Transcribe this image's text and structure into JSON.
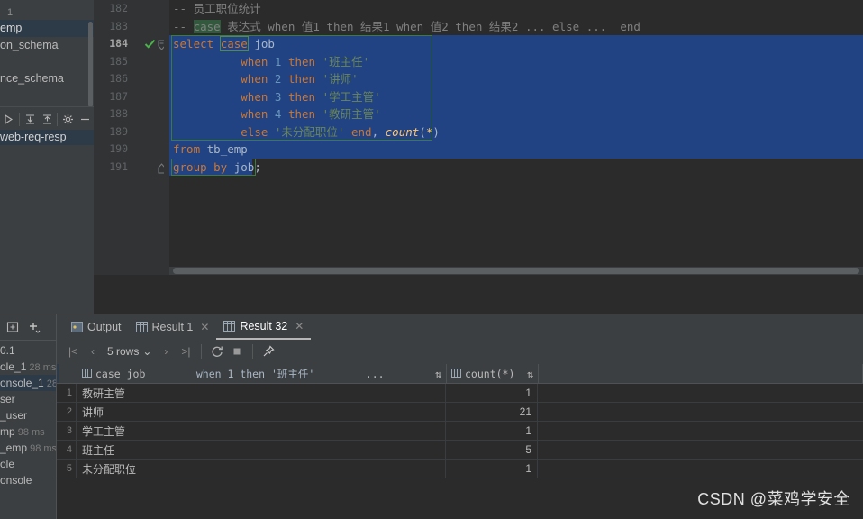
{
  "sidebar": {
    "top_number": "1",
    "tree_items": [
      {
        "label": "emp",
        "selected": true
      },
      {
        "label": "on_schema",
        "selected": false
      },
      {
        "label": "",
        "selected": false
      },
      {
        "label": "nce_schema",
        "selected": false
      }
    ],
    "toolbar_icons": [
      "run-icon",
      "expand-all-icon",
      "collapse-all-icon",
      "gear-icon",
      "minus-icon"
    ],
    "selected_row": "web-req-resp"
  },
  "editor": {
    "lines": [
      {
        "num": "182",
        "current": false,
        "check": false,
        "fold": "none",
        "selection": "none",
        "tokens": [
          {
            "t": "comment",
            "v": "-- 员工职位统计"
          }
        ]
      },
      {
        "num": "183",
        "current": false,
        "check": false,
        "fold": "none",
        "selection": "none",
        "tokens": [
          {
            "t": "comment",
            "v": "-- "
          },
          {
            "t": "comment-hl",
            "v": "case"
          },
          {
            "t": "comment",
            "v": " 表达式 when 值1 then 结果1 when 值2 then 结果2 ... else ...  end"
          }
        ]
      },
      {
        "num": "184",
        "current": true,
        "check": true,
        "fold": "open",
        "selection": "full",
        "tokens": [
          {
            "t": "kw",
            "v": "select "
          },
          {
            "t": "kw-box",
            "v": "case"
          },
          {
            "t": "ident",
            "v": " job"
          }
        ]
      },
      {
        "num": "185",
        "current": false,
        "check": false,
        "fold": "none",
        "selection": "full",
        "tokens": [
          {
            "t": "plain",
            "v": "          "
          },
          {
            "t": "kw",
            "v": "when "
          },
          {
            "t": "num",
            "v": "1"
          },
          {
            "t": "kw",
            "v": " then "
          },
          {
            "t": "str",
            "v": "'班主任'"
          }
        ]
      },
      {
        "num": "186",
        "current": false,
        "check": false,
        "fold": "none",
        "selection": "full",
        "tokens": [
          {
            "t": "plain",
            "v": "          "
          },
          {
            "t": "kw",
            "v": "when "
          },
          {
            "t": "num",
            "v": "2"
          },
          {
            "t": "kw",
            "v": " then "
          },
          {
            "t": "str",
            "v": "'讲师'"
          }
        ]
      },
      {
        "num": "187",
        "current": false,
        "check": false,
        "fold": "none",
        "selection": "full",
        "tokens": [
          {
            "t": "plain",
            "v": "          "
          },
          {
            "t": "kw",
            "v": "when "
          },
          {
            "t": "num",
            "v": "3"
          },
          {
            "t": "kw",
            "v": " then "
          },
          {
            "t": "str",
            "v": "'学工主管'"
          }
        ]
      },
      {
        "num": "188",
        "current": false,
        "check": false,
        "fold": "none",
        "selection": "full",
        "tokens": [
          {
            "t": "plain",
            "v": "          "
          },
          {
            "t": "kw",
            "v": "when "
          },
          {
            "t": "num",
            "v": "4"
          },
          {
            "t": "kw",
            "v": " then "
          },
          {
            "t": "str",
            "v": "'教研主管'"
          }
        ]
      },
      {
        "num": "189",
        "current": false,
        "check": false,
        "fold": "none",
        "selection": "full",
        "tokens": [
          {
            "t": "plain",
            "v": "          "
          },
          {
            "t": "kw",
            "v": "else "
          },
          {
            "t": "str",
            "v": "'未分配职位'"
          },
          {
            "t": "kw",
            "v": " end"
          },
          {
            "t": "op",
            "v": ", "
          },
          {
            "t": "fn",
            "v": "count"
          },
          {
            "t": "op",
            "v": "("
          },
          {
            "t": "fn-star",
            "v": "*"
          },
          {
            "t": "op",
            "v": ")"
          }
        ]
      },
      {
        "num": "190",
        "current": false,
        "check": false,
        "fold": "none",
        "selection": "full",
        "tokens": [
          {
            "t": "kw",
            "v": "from "
          },
          {
            "t": "ident",
            "v": "tb_emp"
          }
        ]
      },
      {
        "num": "191",
        "current": false,
        "check": false,
        "fold": "close",
        "selection": "partial",
        "tokens": [
          {
            "t": "kw",
            "v": "group by "
          },
          {
            "t": "ident",
            "v": "job"
          },
          {
            "t": "op",
            "v": ";"
          }
        ]
      }
    ]
  },
  "history": {
    "toolbar_icons": [
      "new-console-icon",
      "add-icon"
    ],
    "items": [
      {
        "label": "0.1",
        "time": "",
        "selected": false
      },
      {
        "label": "ole_1",
        "time": "28 ms",
        "selected": false
      },
      {
        "label": "onsole_1",
        "time": "28",
        "selected": true
      },
      {
        "label": "ser",
        "time": "",
        "selected": false
      },
      {
        "label": "_user",
        "time": "",
        "selected": false
      },
      {
        "label": "mp",
        "time": "98 ms",
        "selected": false
      },
      {
        "label": "_emp",
        "time": "98 ms",
        "selected": false
      },
      {
        "label": "ole",
        "time": "",
        "selected": false
      },
      {
        "label": "onsole",
        "time": "",
        "selected": false
      }
    ]
  },
  "bottom_panel": {
    "tabs": [
      {
        "label": "Output",
        "icon": "output-icon",
        "active": false,
        "closable": false
      },
      {
        "label": "Result 1",
        "icon": "table-icon",
        "active": false,
        "closable": true
      },
      {
        "label": "Result 32",
        "icon": "table-icon",
        "active": true,
        "closable": true
      }
    ],
    "result_toolbar": {
      "first_label": "|<",
      "prev_label": "‹",
      "rows_label": "5 rows",
      "rows_chevron": "⌄",
      "next_label": "›",
      "last_label": ">|",
      "icons": [
        "refresh-icon",
        "stop-icon",
        "pin-icon"
      ]
    }
  },
  "result_grid": {
    "columns": [
      {
        "key": "col1",
        "icon": "column-icon",
        "label": "case job",
        "mid": "when 1 then '班主任'",
        "ellipsis": "...",
        "sort": "⇅"
      },
      {
        "key": "col2",
        "icon": "column-icon",
        "label": "count(*)",
        "mid": "",
        "ellipsis": "",
        "sort": "⇅"
      }
    ],
    "rows": [
      {
        "n": "1",
        "col1": "教研主管",
        "col2": "1"
      },
      {
        "n": "2",
        "col1": "讲师",
        "col2": "21"
      },
      {
        "n": "3",
        "col1": "学工主管",
        "col2": "1"
      },
      {
        "n": "4",
        "col1": "班主任",
        "col2": "5"
      },
      {
        "n": "5",
        "col1": "未分配职位",
        "col2": "1"
      }
    ]
  },
  "watermark": {
    "text": "CSDN @菜鸡学安全"
  },
  "colors": {
    "editor_bg": "#2b2b2b",
    "panel_bg": "#3c3f41",
    "gutter_bg": "#313335",
    "selection_blue": "#214283",
    "statement_outline_green": "#3b7a45",
    "keyword_orange": "#cc7832",
    "string_green": "#6a8759",
    "number_blue": "#6897bb",
    "identifier": "#a9b7c6",
    "function_yellow": "#ffc66d",
    "comment_gray": "#808080",
    "selected_row_blue": "#2d3a47"
  }
}
